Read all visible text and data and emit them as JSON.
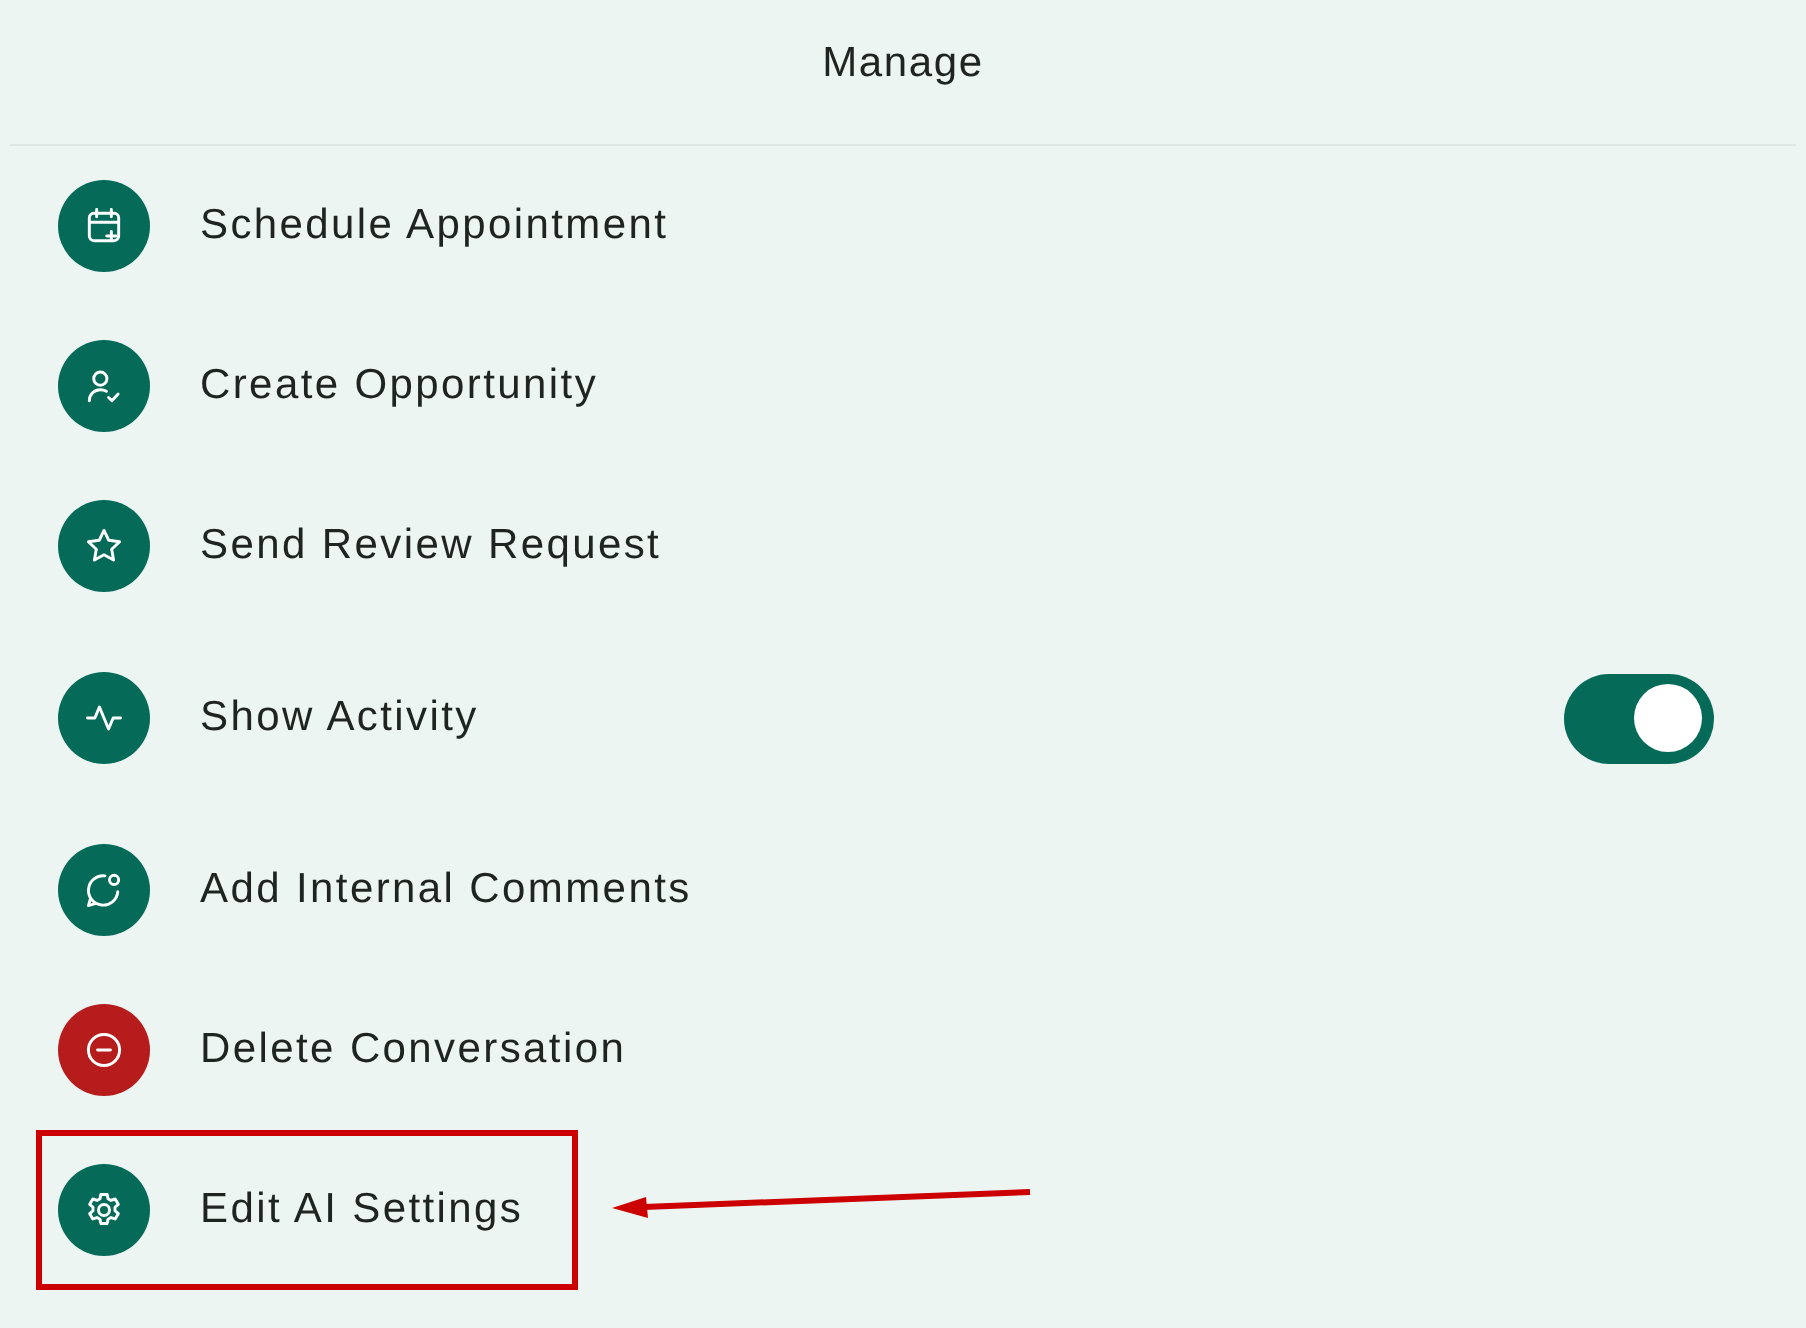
{
  "header": {
    "title": "Manage"
  },
  "items": [
    {
      "kind": "action",
      "label": "Schedule Appointment",
      "color": "#066a59",
      "highlighted": false
    },
    {
      "kind": "action",
      "label": "Create Opportunity",
      "color": "#066a59",
      "highlighted": false
    },
    {
      "kind": "action",
      "label": "Send Review Request",
      "color": "#066a59",
      "highlighted": false
    },
    {
      "kind": "toggle",
      "label": "Show Activity",
      "color": "#066a59",
      "highlighted": false,
      "on": true
    },
    {
      "kind": "action",
      "label": "Add Internal Comments",
      "color": "#066a59",
      "highlighted": false
    },
    {
      "kind": "action",
      "label": "Delete Conversation",
      "color": "#b71c1c",
      "highlighted": false
    },
    {
      "kind": "action",
      "label": "Edit AI Settings",
      "color": "#066a59",
      "highlighted": true
    }
  ]
}
